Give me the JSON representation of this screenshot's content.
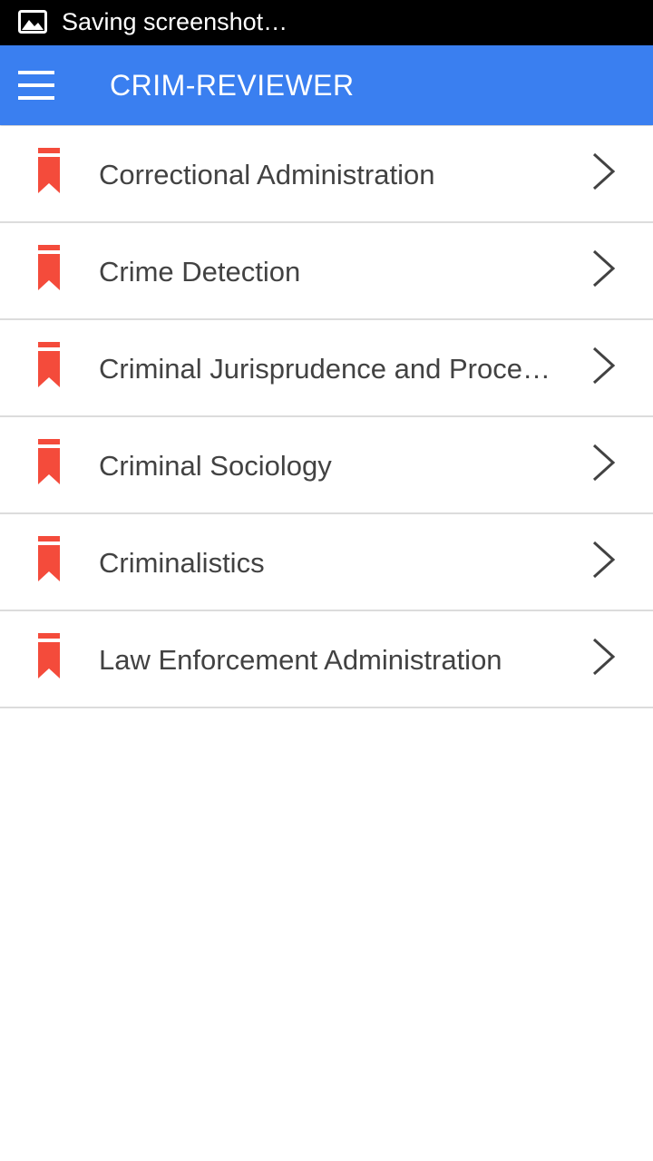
{
  "status_bar": {
    "icon": "image-icon",
    "text": "Saving screenshot…"
  },
  "app_bar": {
    "menu_icon": "hamburger-menu-icon",
    "title": "CRIM-REVIEWER",
    "color": "#3a7ff0"
  },
  "colors": {
    "bookmark": "#f44b3b",
    "text": "#424242",
    "divider": "#dcdcdc"
  },
  "subjects": [
    {
      "label": "Correctional Administration",
      "icon": "bookmark-icon",
      "trailing_icon": "chevron-right-icon"
    },
    {
      "label": "Crime Detection",
      "icon": "bookmark-icon",
      "trailing_icon": "chevron-right-icon"
    },
    {
      "label": "Criminal Jurisprudence and Proce…",
      "icon": "bookmark-icon",
      "trailing_icon": "chevron-right-icon"
    },
    {
      "label": "Criminal Sociology",
      "icon": "bookmark-icon",
      "trailing_icon": "chevron-right-icon"
    },
    {
      "label": "Criminalistics",
      "icon": "bookmark-icon",
      "trailing_icon": "chevron-right-icon"
    },
    {
      "label": "Law Enforcement Administration",
      "icon": "bookmark-icon",
      "trailing_icon": "chevron-right-icon"
    }
  ]
}
